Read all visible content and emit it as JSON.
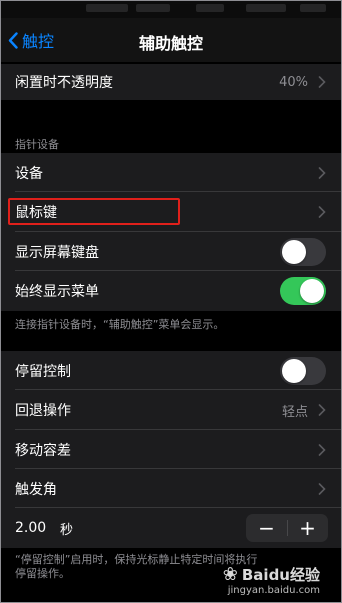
{
  "nav": {
    "back_label": "触控",
    "title": "辅助触控"
  },
  "opacity_row": {
    "label": "闲置时不透明度",
    "value": "40%"
  },
  "pointer_section": {
    "header": "指针设备",
    "rows": [
      {
        "label": "设备"
      },
      {
        "label": "鼠标键"
      },
      {
        "label": "显示屏幕键盘",
        "toggle": false
      },
      {
        "label": "始终显示菜单",
        "toggle": true
      }
    ],
    "footer": "连接指针设备时，“辅助触控”菜单会显示。"
  },
  "dwell_section": {
    "rows": [
      {
        "label": "停留控制",
        "toggle": false
      },
      {
        "label": "回退操作",
        "value": "轻点"
      },
      {
        "label": "移动容差"
      },
      {
        "label": "触发角"
      }
    ],
    "timer": {
      "value": "2.00",
      "unit": "秒",
      "minus": "−",
      "plus": "+"
    },
    "footer": "“停留控制”启用时，保持光标静止特定时间将执行"
  },
  "footer_cont": "停留操作。",
  "watermark": {
    "brand": "Baidu经验",
    "url": "jingyan.baidu.com"
  },
  "colors": {
    "accent": "#0a84ff",
    "switch_on": "#34c759",
    "highlight": "#e0201b"
  }
}
